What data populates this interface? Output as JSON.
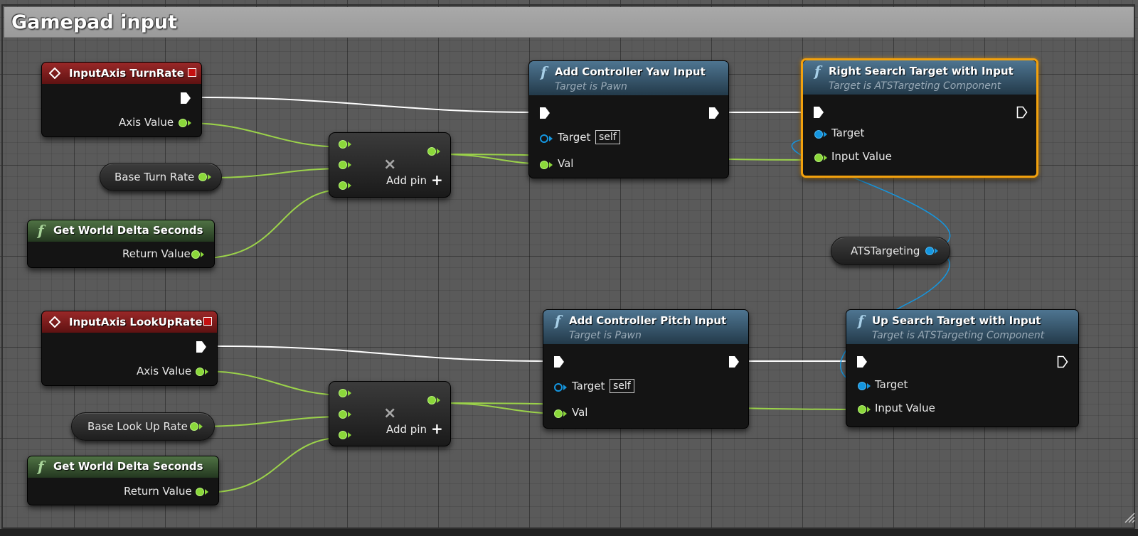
{
  "comment": {
    "title": "Gamepad input"
  },
  "nodes": {
    "turn_event": {
      "title": "InputAxis TurnRate",
      "axis_label": "Axis Value"
    },
    "base_turn_rate": {
      "label": "Base Turn Rate"
    },
    "get_delta_1": {
      "title": "Get World Delta Seconds",
      "return_label": "Return Value"
    },
    "multiply_1": {
      "symbol": "×",
      "add_pin": "Add pin",
      "plus": "+"
    },
    "yaw_input": {
      "title": "Add Controller Yaw Input",
      "subtitle": "Target is Pawn",
      "target_label": "Target",
      "target_value": "self",
      "val_label": "Val"
    },
    "right_search": {
      "title": "Right Search Target with Input",
      "subtitle": "Target is ATSTargeting Component",
      "target_label": "Target",
      "input_label": "Input Value"
    },
    "ats_targeting": {
      "label": "ATSTargeting"
    },
    "lookup_event": {
      "title": "InputAxis LookUpRate",
      "axis_label": "Axis Value"
    },
    "base_lookup_rate": {
      "label": "Base Look Up Rate"
    },
    "get_delta_2": {
      "title": "Get World Delta Seconds",
      "return_label": "Return Value"
    },
    "multiply_2": {
      "symbol": "×",
      "add_pin": "Add pin",
      "plus": "+"
    },
    "pitch_input": {
      "title": "Add Controller Pitch Input",
      "subtitle": "Target is Pawn",
      "target_label": "Target",
      "target_value": "self",
      "val_label": "Val"
    },
    "up_search": {
      "title": "Up Search Target with Input",
      "subtitle": "Target is ATSTargeting Component",
      "target_label": "Target",
      "input_label": "Input Value"
    }
  },
  "colors": {
    "float_wire": "#9bd24a",
    "object_wire": "#1496e0",
    "exec_wire": "#ffffff",
    "selection": "#f2a10d"
  }
}
